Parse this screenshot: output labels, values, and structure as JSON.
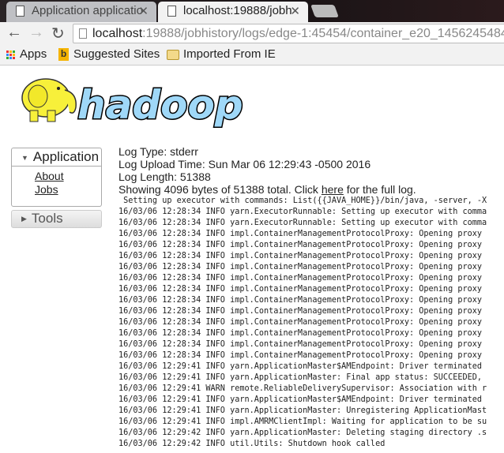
{
  "browser": {
    "tabs": [
      {
        "title": "Application applicatio",
        "active": false
      },
      {
        "title": "localhost:19888/jobh",
        "active": true
      }
    ],
    "url_host": "localhost",
    "url_rest": ":19888/jobhistory/logs/edge-1:45454/container_e20_1456245484",
    "bookmarks": [
      {
        "label": "Apps",
        "icon": "apps-grid-icon"
      },
      {
        "label": "Suggested Sites",
        "icon": "bing-icon"
      },
      {
        "label": "Imported From IE",
        "icon": "folder-icon"
      }
    ]
  },
  "logo": {
    "text": "hadoop",
    "colors": {
      "text": "#9fd8f8",
      "elephant": "#f7f03a"
    }
  },
  "sidebar": {
    "application": {
      "label": "Application",
      "links": [
        "About",
        "Jobs"
      ]
    },
    "tools": {
      "label": "Tools"
    }
  },
  "log": {
    "type_line": "Log Type: stderr",
    "upload_line": "Log Upload Time: Sun Mar 06 12:29:43 -0500 2016",
    "length_line": "Log Length: 51388",
    "showing_prefix": "Showing 4096 bytes of 51388 total. Click ",
    "here_link": "here",
    "showing_suffix": " for the full log.",
    "lines": [
      " Setting up executor with commands: List({{JAVA_HOME}}/bin/java, -server, -X",
      "16/03/06 12:28:34 INFO yarn.ExecutorRunnable: Setting up executor with comma",
      "16/03/06 12:28:34 INFO yarn.ExecutorRunnable: Setting up executor with comma",
      "16/03/06 12:28:34 INFO impl.ContainerManagementProtocolProxy: Opening proxy",
      "16/03/06 12:28:34 INFO impl.ContainerManagementProtocolProxy: Opening proxy",
      "16/03/06 12:28:34 INFO impl.ContainerManagementProtocolProxy: Opening proxy",
      "16/03/06 12:28:34 INFO impl.ContainerManagementProtocolProxy: Opening proxy",
      "16/03/06 12:28:34 INFO impl.ContainerManagementProtocolProxy: Opening proxy",
      "16/03/06 12:28:34 INFO impl.ContainerManagementProtocolProxy: Opening proxy",
      "16/03/06 12:28:34 INFO impl.ContainerManagementProtocolProxy: Opening proxy",
      "16/03/06 12:28:34 INFO impl.ContainerManagementProtocolProxy: Opening proxy",
      "16/03/06 12:28:34 INFO impl.ContainerManagementProtocolProxy: Opening proxy",
      "16/03/06 12:28:34 INFO impl.ContainerManagementProtocolProxy: Opening proxy",
      "16/03/06 12:28:34 INFO impl.ContainerManagementProtocolProxy: Opening proxy",
      "16/03/06 12:28:34 INFO impl.ContainerManagementProtocolProxy: Opening proxy",
      "16/03/06 12:29:41 INFO yarn.ApplicationMaster$AMEndpoint: Driver terminated",
      "16/03/06 12:29:41 INFO yarn.ApplicationMaster: Final app status: SUCCEEDED,",
      "16/03/06 12:29:41 WARN remote.ReliableDeliverySupervisor: Association with r",
      "16/03/06 12:29:41 INFO yarn.ApplicationMaster$AMEndpoint: Driver terminated",
      "16/03/06 12:29:41 INFO yarn.ApplicationMaster: Unregistering ApplicationMast",
      "16/03/06 12:29:41 INFO impl.AMRMClientImpl: Waiting for application to be su",
      "16/03/06 12:29:42 INFO yarn.ApplicationMaster: Deleting staging directory .s",
      "16/03/06 12:29:42 INFO util.Utils: Shutdown hook called"
    ]
  }
}
